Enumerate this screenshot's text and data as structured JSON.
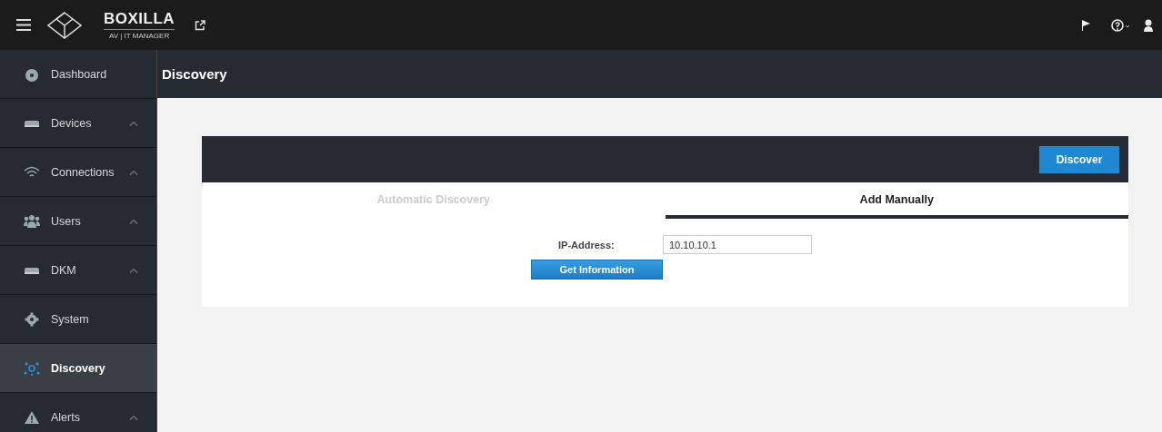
{
  "header": {
    "logo_title": "BOXILLA",
    "logo_subtitle": "AV | IT MANAGER"
  },
  "sidebar": {
    "items": [
      {
        "label": "Dashboard",
        "kind": "dashboard",
        "has_submenu": false,
        "selected": false
      },
      {
        "label": "Devices",
        "kind": "device",
        "has_submenu": true,
        "selected": false
      },
      {
        "label": "Connections",
        "kind": "wifi",
        "has_submenu": true,
        "selected": false
      },
      {
        "label": "Users",
        "kind": "users",
        "has_submenu": true,
        "selected": false
      },
      {
        "label": "DKM",
        "kind": "device",
        "has_submenu": true,
        "selected": false
      },
      {
        "label": "System",
        "kind": "gear",
        "has_submenu": false,
        "selected": false
      },
      {
        "label": "Discovery",
        "kind": "network",
        "has_submenu": false,
        "selected": true
      },
      {
        "label": "Alerts",
        "kind": "warning",
        "has_submenu": true,
        "selected": false
      }
    ]
  },
  "page": {
    "title": "Discovery",
    "discover_button": "Discover",
    "tabs": [
      {
        "label": "Automatic Discovery",
        "selected": false
      },
      {
        "label": "Add Manually",
        "selected": true
      }
    ],
    "form": {
      "label": "IP-Address:",
      "value": "10.10.10.1",
      "button": "Get Information"
    }
  }
}
